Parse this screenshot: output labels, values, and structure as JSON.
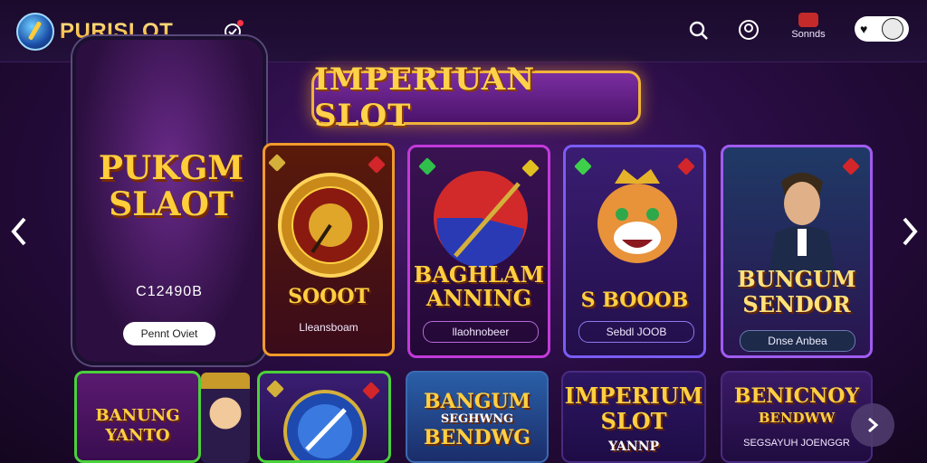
{
  "brand": {
    "name": "PURISLOT"
  },
  "header": {
    "sounds_label": "Sonnds"
  },
  "banner": {
    "title": "IMPERIUAN SLOT"
  },
  "featured": {
    "title_line1": "PUKGM",
    "title_line2": "SLAOT",
    "amount": "C12490B",
    "button_label": "Pennt Oviet"
  },
  "cards": [
    {
      "title": "SOOOT",
      "subtitle": "Lleansboam"
    },
    {
      "title_line1": "BAGHLAM",
      "title_line2": "ANNING",
      "button_label": "llaohnobeer"
    },
    {
      "title": "S BOOOB",
      "button_label": "Sebdl JOOB"
    },
    {
      "title_line1": "BUNGUM",
      "title_line2": "SENDOR",
      "button_label": "Dnse Anbea"
    }
  ],
  "row2": [
    {
      "title_line1": "BANUNG",
      "title_line2": "YANTO"
    },
    {
      "title": ""
    },
    {
      "title_line1": "BANGUM",
      "title_line2": "SEGHWNG",
      "title_line3": "BENDWG"
    },
    {
      "title_line1": "IMPERIUM",
      "title_line2": "SLOT",
      "title_line3": "YANNP"
    },
    {
      "title_line1": "BENICNOY",
      "title_line2": "BENDWW",
      "subtitle": "SEGSAYUH JOENGGR"
    }
  ],
  "colors": {
    "accent_gold": "#ffcf40",
    "bg": "#2a0d45"
  }
}
